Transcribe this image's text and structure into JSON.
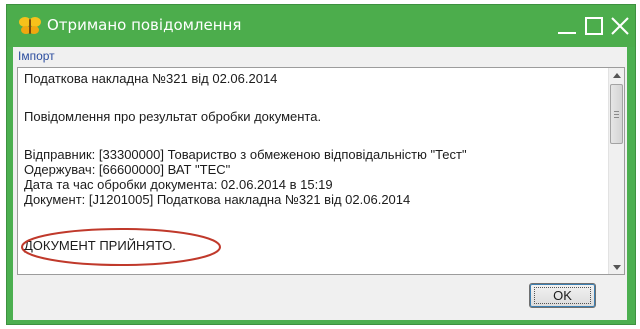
{
  "window": {
    "title": "Отримано повідомлення",
    "titlebar_color": "#4cad4c",
    "icon": "butterfly-app-icon",
    "controls": {
      "minimize": "minimize-icon",
      "maximize": "maximize-icon",
      "close": "close-icon"
    }
  },
  "section": {
    "label": "Імпорт"
  },
  "message": {
    "lines": [
      "Податкова накладна  №321 від 02.06.2014",
      "Повідомлення про результат обробки документа.",
      "Відправник: [33300000] Товариство з обмеженою відповідальністю \"Тест\"",
      "Одержувач:  [66600000] ВАТ \"ТЕС\"",
      "Дата та час обробки документа: 02.06.2014 в 15:19",
      "Документ: [J1201005] Податкова накладна  №321 від 02.06.2014",
      "ДОКУМЕНТ ПРИЙНЯТО."
    ],
    "highlight_color": "#c0392b"
  },
  "buttons": {
    "ok_label": "OK"
  }
}
